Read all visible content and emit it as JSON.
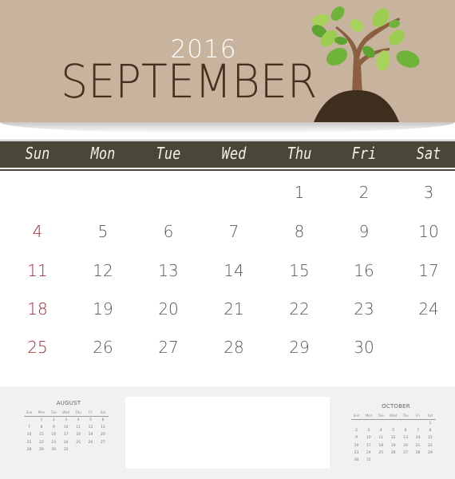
{
  "header": {
    "year": "2016",
    "month": "SEPTEMBER",
    "colors": {
      "band": "#c8b39e",
      "month_text": "#4a2e1e",
      "year_text": "#ffffff",
      "weekbar": "#4a4638",
      "sunday": "#a32a2e"
    }
  },
  "weekdays": [
    "Sun",
    "Mon",
    "Tue",
    "Wed",
    "Thu",
    "Fri",
    "Sat"
  ],
  "main_calendar": {
    "weeks": [
      [
        "",
        "",
        "",
        "",
        "1",
        "2",
        "3"
      ],
      [
        "4",
        "5",
        "6",
        "7",
        "8",
        "9",
        "10"
      ],
      [
        "11",
        "12",
        "13",
        "14",
        "15",
        "16",
        "17"
      ],
      [
        "18",
        "19",
        "20",
        "21",
        "22",
        "23",
        "24"
      ],
      [
        "25",
        "26",
        "27",
        "28",
        "29",
        "30",
        ""
      ]
    ]
  },
  "mini_calendars": {
    "august": {
      "title": "AUGUST",
      "weekdays": [
        "Sun",
        "Mon",
        "Tue",
        "Wed",
        "Thu",
        "Fri",
        "Sat"
      ],
      "weeks": [
        [
          "",
          "1",
          "2",
          "3",
          "4",
          "5",
          "6"
        ],
        [
          "7",
          "8",
          "9",
          "10",
          "11",
          "12",
          "13"
        ],
        [
          "14",
          "15",
          "16",
          "17",
          "18",
          "19",
          "20"
        ],
        [
          "21",
          "22",
          "23",
          "24",
          "25",
          "26",
          "27"
        ],
        [
          "28",
          "29",
          "30",
          "31",
          "",
          "",
          ""
        ]
      ]
    },
    "october": {
      "title": "OCTOBER",
      "weekdays": [
        "Sun",
        "Mon",
        "Tue",
        "Wed",
        "Thu",
        "Fri",
        "Sat"
      ],
      "weeks": [
        [
          "",
          "",
          "",
          "",
          "",
          "",
          "1"
        ],
        [
          "2",
          "3",
          "4",
          "5",
          "6",
          "7",
          "8"
        ],
        [
          "9",
          "10",
          "11",
          "12",
          "13",
          "14",
          "15"
        ],
        [
          "16",
          "17",
          "18",
          "19",
          "20",
          "21",
          "22"
        ],
        [
          "23",
          "24",
          "25",
          "26",
          "27",
          "28",
          "29"
        ],
        [
          "30",
          "31",
          "",
          "",
          "",
          "",
          ""
        ]
      ]
    }
  },
  "notes_box": {
    "text": ""
  }
}
